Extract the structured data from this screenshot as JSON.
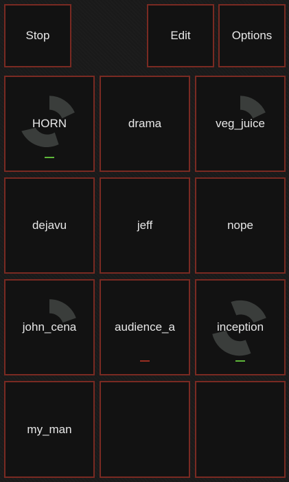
{
  "toolbar": {
    "stop_label": "Stop",
    "edit_label": "Edit",
    "options_label": "Options"
  },
  "pads": [
    {
      "label": "HORN",
      "playing": true,
      "indicator": "green"
    },
    {
      "label": "drama",
      "playing": false,
      "indicator": ""
    },
    {
      "label": "veg_juice",
      "playing": true,
      "indicator": ""
    },
    {
      "label": "dejavu",
      "playing": false,
      "indicator": ""
    },
    {
      "label": "jeff",
      "playing": false,
      "indicator": ""
    },
    {
      "label": "nope",
      "playing": false,
      "indicator": ""
    },
    {
      "label": "john_cena",
      "playing": true,
      "indicator": ""
    },
    {
      "label": "audience_a",
      "playing": false,
      "indicator": "red"
    },
    {
      "label": "inception",
      "playing": true,
      "indicator": "green"
    },
    {
      "label": "my_man",
      "playing": false,
      "indicator": ""
    },
    {
      "label": "",
      "playing": false,
      "indicator": ""
    },
    {
      "label": "",
      "playing": false,
      "indicator": ""
    }
  ],
  "colors": {
    "border": "#7a2a22",
    "pad_bg": "#121212",
    "text": "#e8e8e8",
    "progress_arc": "#3a3d3b",
    "indicator_green": "#5fb83a",
    "indicator_red": "#9a2e22"
  }
}
